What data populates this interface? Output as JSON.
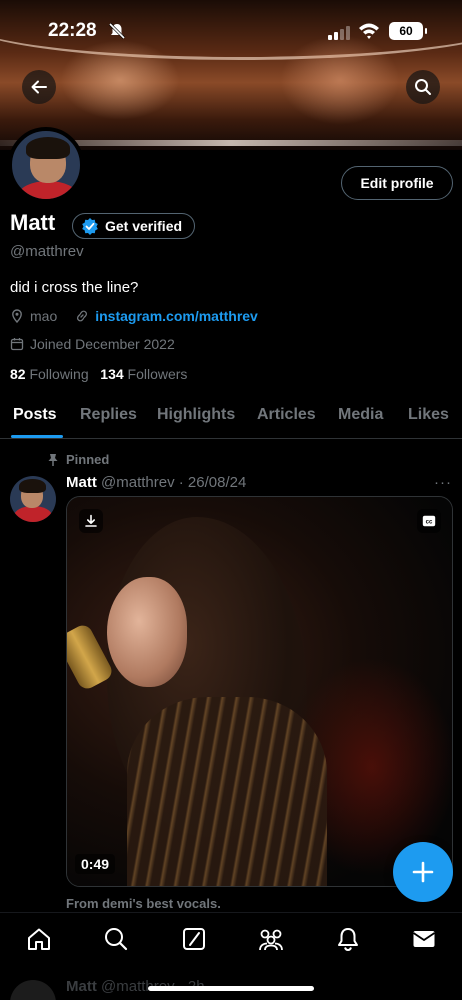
{
  "status_bar": {
    "time": "22:28",
    "battery": "60"
  },
  "profile": {
    "name": "Matt",
    "verify_label": "Get verified",
    "handle": "@matthrev",
    "bio": "did i cross the line?",
    "location": "mao",
    "link": "instagram.com/matthrev",
    "joined": "Joined December 2022",
    "following_count": "82",
    "following_label": "Following",
    "followers_count": "134",
    "followers_label": "Followers",
    "edit_label": "Edit profile"
  },
  "tabs": [
    {
      "label": "Posts",
      "active": true
    },
    {
      "label": "Replies",
      "active": false
    },
    {
      "label": "Highlights",
      "active": false
    },
    {
      "label": "Articles",
      "active": false
    },
    {
      "label": "Media",
      "active": false
    },
    {
      "label": "Likes",
      "active": false
    }
  ],
  "pinned_post": {
    "pinned_label": "Pinned",
    "author": "Matt",
    "handle_date": "@matthrev · 26/08/24",
    "more": "···",
    "video_duration": "0:49",
    "caption": "From demi's best vocals."
  },
  "next_post": {
    "author": "Matt",
    "handle_date": "@matthrev · 2h"
  },
  "icons": {
    "back": "arrow-left-icon",
    "search": "search-icon",
    "verified": "verified-badge-icon",
    "location": "location-pin-icon",
    "link": "link-icon",
    "calendar": "calendar-icon",
    "pin": "pin-icon",
    "download": "download-icon",
    "cc": "closed-captions-icon",
    "compose": "plus-icon",
    "nav": [
      "home-icon",
      "search-icon",
      "grok-icon",
      "communities-icon",
      "bell-icon",
      "mail-icon"
    ]
  },
  "colors": {
    "accent": "#1d9bf0",
    "background": "#000000",
    "muted": "#71767b"
  }
}
